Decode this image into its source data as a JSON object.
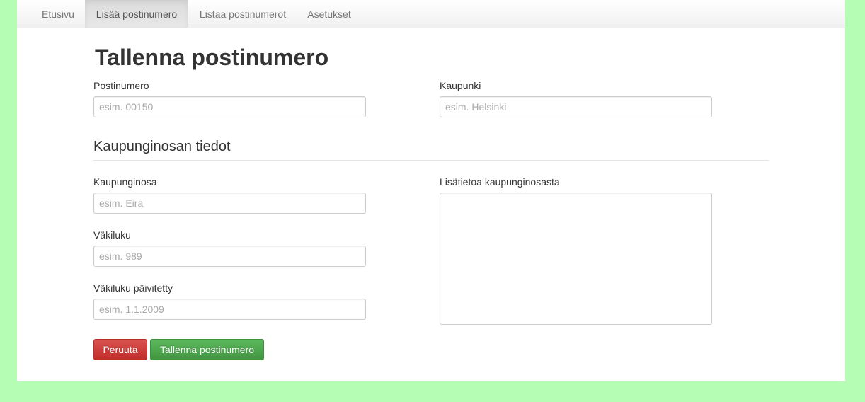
{
  "nav": {
    "items": [
      {
        "label": "Etusivu",
        "active": false
      },
      {
        "label": "Lisää postinumero",
        "active": true
      },
      {
        "label": "Listaa postinumerot",
        "active": false
      },
      {
        "label": "Asetukset",
        "active": false
      }
    ]
  },
  "form": {
    "title": "Tallenna postinumero",
    "postal_code": {
      "label": "Postinumero",
      "placeholder": "esim. 00150",
      "value": ""
    },
    "city": {
      "label": "Kaupunki",
      "placeholder": "esim. Helsinki",
      "value": ""
    },
    "district_section_title": "Kaupunginosan tiedot",
    "district": {
      "label": "Kaupunginosa",
      "placeholder": "esim. Eira",
      "value": ""
    },
    "population": {
      "label": "Väkiluku",
      "placeholder": "esim. 989",
      "value": ""
    },
    "population_updated": {
      "label": "Väkiluku päivitetty",
      "placeholder": "esim. 1.1.2009",
      "value": ""
    },
    "district_info": {
      "label": "Lisätietoa kaupunginosasta",
      "value": ""
    },
    "cancel_label": "Peruuta",
    "save_label": "Tallenna postinumero"
  },
  "colors": {
    "page_background": "#b5fdb5",
    "danger": "#d9534f",
    "success": "#5cb85c"
  }
}
